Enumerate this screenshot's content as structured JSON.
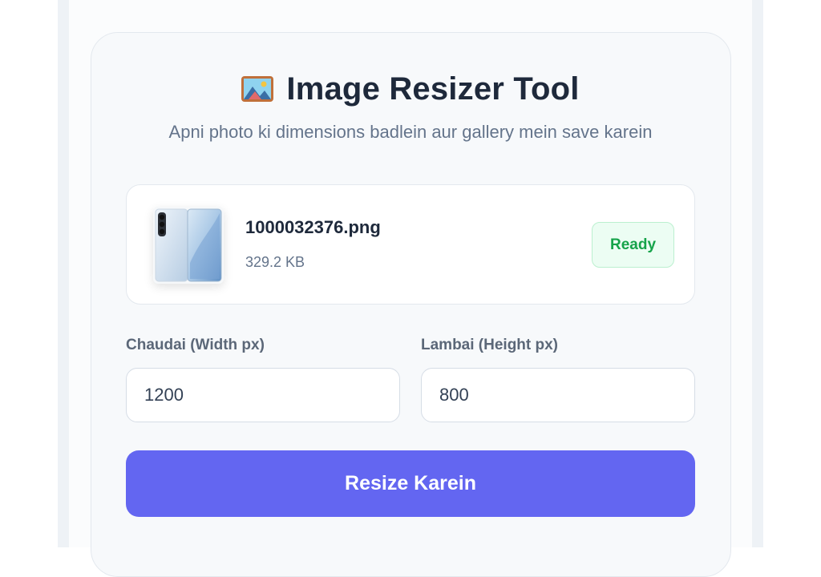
{
  "header": {
    "icon": "framed-picture-icon",
    "title": "Image Resizer Tool",
    "subtitle": "Apni photo ki dimensions badlein aur gallery mein save karein"
  },
  "file": {
    "thumbnail_icon": "phone-image-thumbnail",
    "name": "1000032376.png",
    "size": "329.2 KB",
    "status": "Ready"
  },
  "form": {
    "width_label": "Chaudai (Width px)",
    "width_value": "1200",
    "height_label": "Lambai (Height px)",
    "height_value": "800",
    "submit_label": "Resize Karein"
  },
  "colors": {
    "accent": "#6366f1",
    "success": "#16a34a",
    "title": "#1e293b",
    "muted": "#64748b"
  }
}
